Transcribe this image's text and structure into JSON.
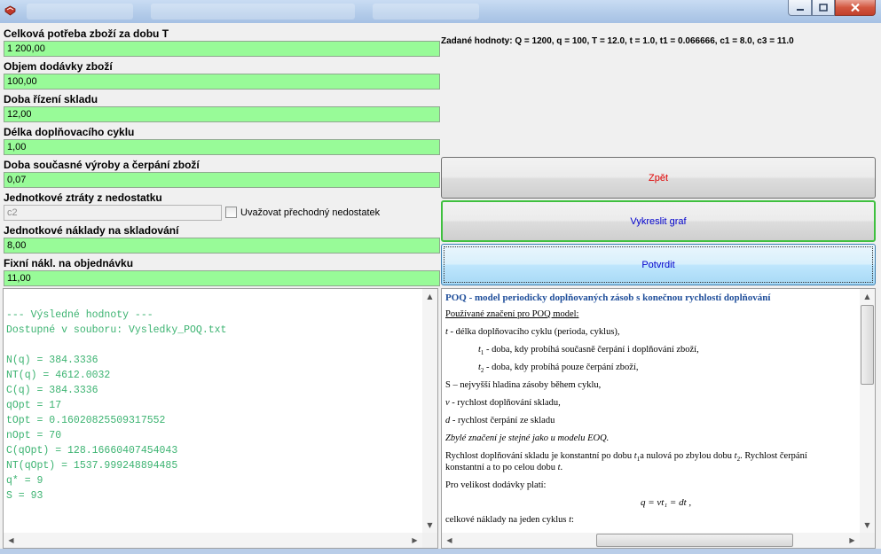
{
  "fields": [
    {
      "label": "Celková potřeba zboží za dobu T",
      "value": "1 200,00"
    },
    {
      "label": "Objem dodávky zboží",
      "value": "100,00"
    },
    {
      "label": "Doba řízení skladu",
      "value": "12,00"
    },
    {
      "label": "Délka doplňovacího cyklu",
      "value": "1,00"
    },
    {
      "label": "Doba současné výroby a čerpání zboží",
      "value": "0,07"
    },
    {
      "label": "Jednotkové ztráty z nedostatku",
      "value": "c2"
    },
    {
      "label": "Jednotkové náklady na skladování",
      "value": "8,00"
    },
    {
      "label": "Fixní nákl. na objednávku",
      "value": "11,00"
    }
  ],
  "shortage_checkbox": {
    "label": "Uvažovat přechodný nedostatek",
    "checked": false
  },
  "given_values": "Zadané hodnoty: Q = 1200, q = 100, T = 12.0, t = 1.0, t1 = 0.066666, c1 = 8.0, c3 = 11.0",
  "buttons": {
    "back": "Zpět",
    "graph": "Vykreslit graf",
    "confirm": "Potvrdit"
  },
  "output_lines": [
    "--- Výsledné hodnoty ---",
    "Dostupné v souboru: Vysledky_POQ.txt",
    "",
    "N(q) = 384.3336",
    "NT(q) = 4612.0032",
    "C(q) = 384.3336",
    "qOpt = 17",
    "tOpt = 0.16020825509317552",
    "nOpt = 70",
    "C(qOpt) = 128.16660407454043",
    "NT(qOpt) = 1537.999248894485",
    "q* = 9",
    "S = 93"
  ],
  "help": {
    "title": "POQ - model periodicky doplňovaných zásob s konečnou rychlostí doplňování",
    "notation_heading": "Používané značení pro POQ model:",
    "t_def": " - délka doplňovacího cyklu (perioda, cyklus),",
    "t1_def": " - doba, kdy probíhá současně čerpání i doplňování zboží,",
    "t2_def": " - doba, kdy probíhá pouze čerpání zboží,",
    "s_def": "S – nejvyšší hladina zásoby během cyklu,",
    "v_def": " - rychlost doplňování skladu,",
    "d_def": " - rychlost čerpání ze skladu",
    "rest_note": "Zbylé značení je stejné jako u modelu EOQ.",
    "rate_line1": "Rychlost doplňování skladu je konstantní po dobu ",
    "rate_line1b": "a nulová po zbylou dobu ",
    "rate_line1c": ". Rychlost čerpání",
    "rate_line2": "konstantní a to po celou dobu ",
    "delivery_intro": "Pro velikost dodávky platí:",
    "formula": "q = vt₁ = dt  ,",
    "cost_intro": "celkové náklady na jeden cyklus "
  }
}
